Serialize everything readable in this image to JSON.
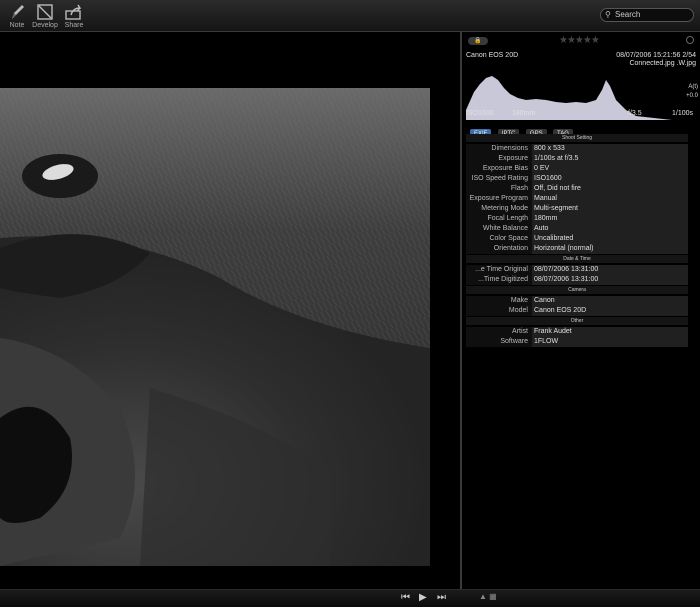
{
  "toolbar": {
    "items": [
      {
        "label": "Note",
        "icon": "pencil-icon"
      },
      {
        "label": "Develop",
        "icon": "develop-icon"
      },
      {
        "label": "Share",
        "icon": "share-icon"
      }
    ]
  },
  "search": {
    "placeholder": "Search"
  },
  "panel": {
    "camera": "Canon EOS 20D",
    "datetime": "08/07/2006 15:21:56 2/54",
    "filename": "Connected.jpg .W.jpg",
    "hist_side": [
      "A(t)",
      "wb",
      "+0.0"
    ],
    "hist_info": [
      "ISO1600",
      "180mm",
      "f/3.5",
      "1/100s"
    ],
    "tabs": [
      "EXIF",
      "IPTC",
      "GPS",
      "TAG"
    ],
    "rating_stars": 5,
    "rating_value": 0
  },
  "exif": {
    "shoot_title": "Shoot Setting",
    "shoot": [
      {
        "k": "Dimensions",
        "v": "800 x 533"
      },
      {
        "k": "Exposure",
        "v": "1/100s at f/3.5"
      },
      {
        "k": "Exposure Bias",
        "v": "0 EV"
      },
      {
        "k": "ISO Speed Rating",
        "v": "ISO1600"
      },
      {
        "k": "Flash",
        "v": "Off, Did not fire"
      },
      {
        "k": "Exposure Program",
        "v": "Manual"
      },
      {
        "k": "Metering Mode",
        "v": "Multi-segment"
      },
      {
        "k": "Focal Length",
        "v": "180mm"
      },
      {
        "k": "White Balance",
        "v": "Auto"
      },
      {
        "k": "Color Space",
        "v": "Uncalibrated"
      },
      {
        "k": "Orientation",
        "v": "Horizontal (normal)"
      }
    ],
    "dt_title": "Date & Time",
    "dt": [
      {
        "k": "...e Time Original",
        "v": "08/07/2006 13:31:00"
      },
      {
        "k": "...Time Digitized",
        "v": "08/07/2006 13:31:00"
      }
    ],
    "cam_title": "Camera",
    "cam": [
      {
        "k": "Make",
        "v": "Canon"
      },
      {
        "k": "Model",
        "v": "Canon EOS 20D"
      }
    ],
    "other_title": "Other",
    "other": [
      {
        "k": "Artist",
        "v": "Frank Audet"
      },
      {
        "k": "Software",
        "v": "1FLOW"
      }
    ]
  }
}
